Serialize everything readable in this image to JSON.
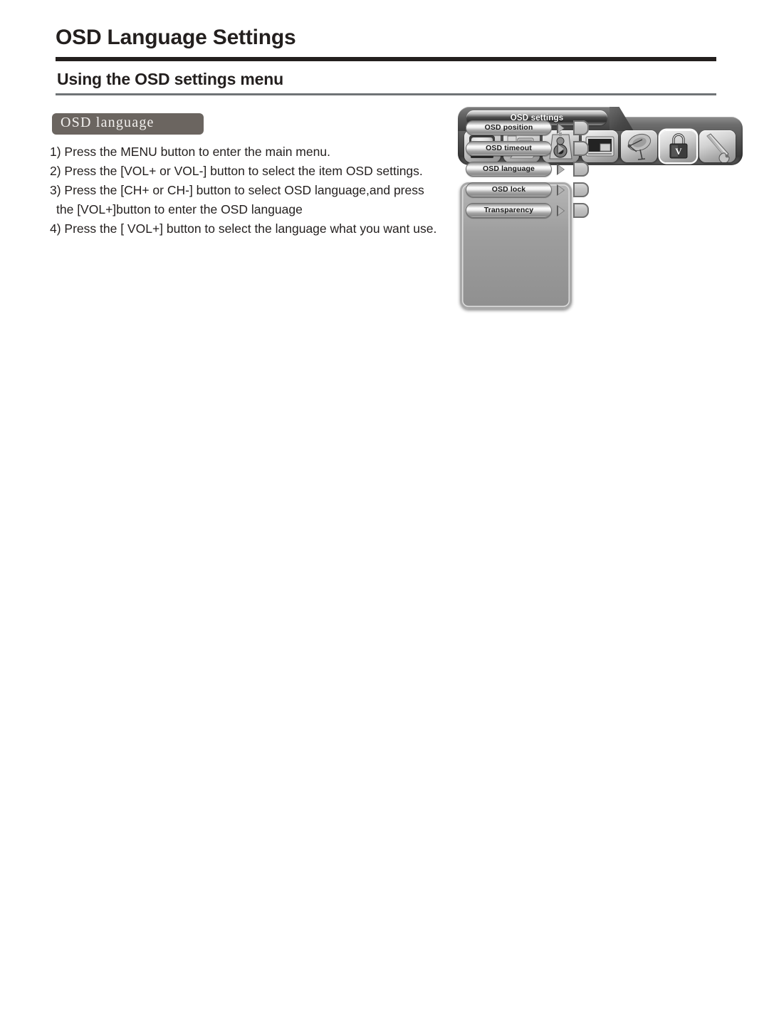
{
  "page": {
    "title": "OSD Language Settings",
    "section_title": "Using the OSD settings  menu",
    "subsection_tag": "OSD language"
  },
  "instructions": {
    "steps": [
      "1) Press the MENU button to enter the main menu.",
      "2) Press the [VOL+ or VOL-] button to select the item OSD settings.",
      "3) Press the [CH+ or CH-] button to select OSD language,and press",
      "the [VOL+]button  to enter the OSD language",
      "4) Press the  [ VOL+]  button to select the language what you want use."
    ]
  },
  "osd": {
    "tab_label": "OSD settings",
    "icons": [
      {
        "name": "tv-icon",
        "label": "TV picture",
        "selected": false
      },
      {
        "name": "computer-icon",
        "label": "PC setup",
        "selected": false
      },
      {
        "name": "speaker-icon",
        "label": "Sound",
        "selected": false
      },
      {
        "name": "screen-icon",
        "label": "Screen",
        "selected": false
      },
      {
        "name": "satellite-dish-icon",
        "label": "Tuner",
        "selected": false
      },
      {
        "name": "lock-icon",
        "label": "OSD settings",
        "selected": true
      },
      {
        "name": "wrench-icon",
        "label": "Tools",
        "selected": false
      }
    ],
    "menu_items": [
      {
        "label": "OSD position",
        "value": ""
      },
      {
        "label": "OSD timeout",
        "value": ""
      },
      {
        "label": "OSD language",
        "value": ""
      },
      {
        "label": "OSD lock",
        "value": ""
      },
      {
        "label": "Transparency",
        "value": ""
      }
    ]
  },
  "colors": {
    "rule_dark": "#231f1e",
    "rule_light": "#6f7376",
    "tag_background": "#6b6560",
    "tag_text": "#f3f1ef",
    "body_text": "#231f1e"
  }
}
